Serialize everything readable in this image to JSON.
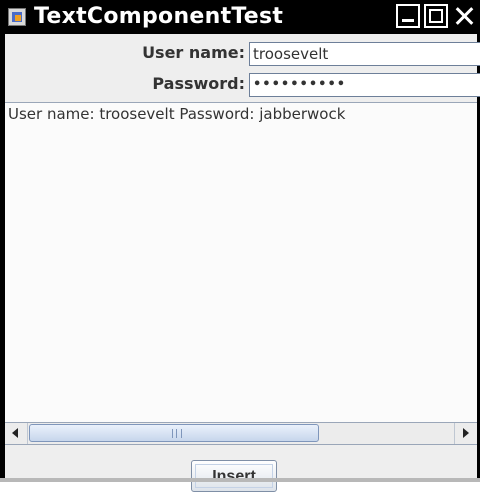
{
  "window": {
    "title": "TextComponentTest",
    "icon": "java-app-icon",
    "buttons": [
      "minimize-icon",
      "maximize-icon",
      "close-icon"
    ]
  },
  "form": {
    "username_label": "User name:",
    "username_value": "troosevelt",
    "password_label": "Password:",
    "password_mask": "••••••••••"
  },
  "output": {
    "text": "User name: troosevelt Password: jabberwock"
  },
  "actions": {
    "insert_label": "Insert"
  }
}
